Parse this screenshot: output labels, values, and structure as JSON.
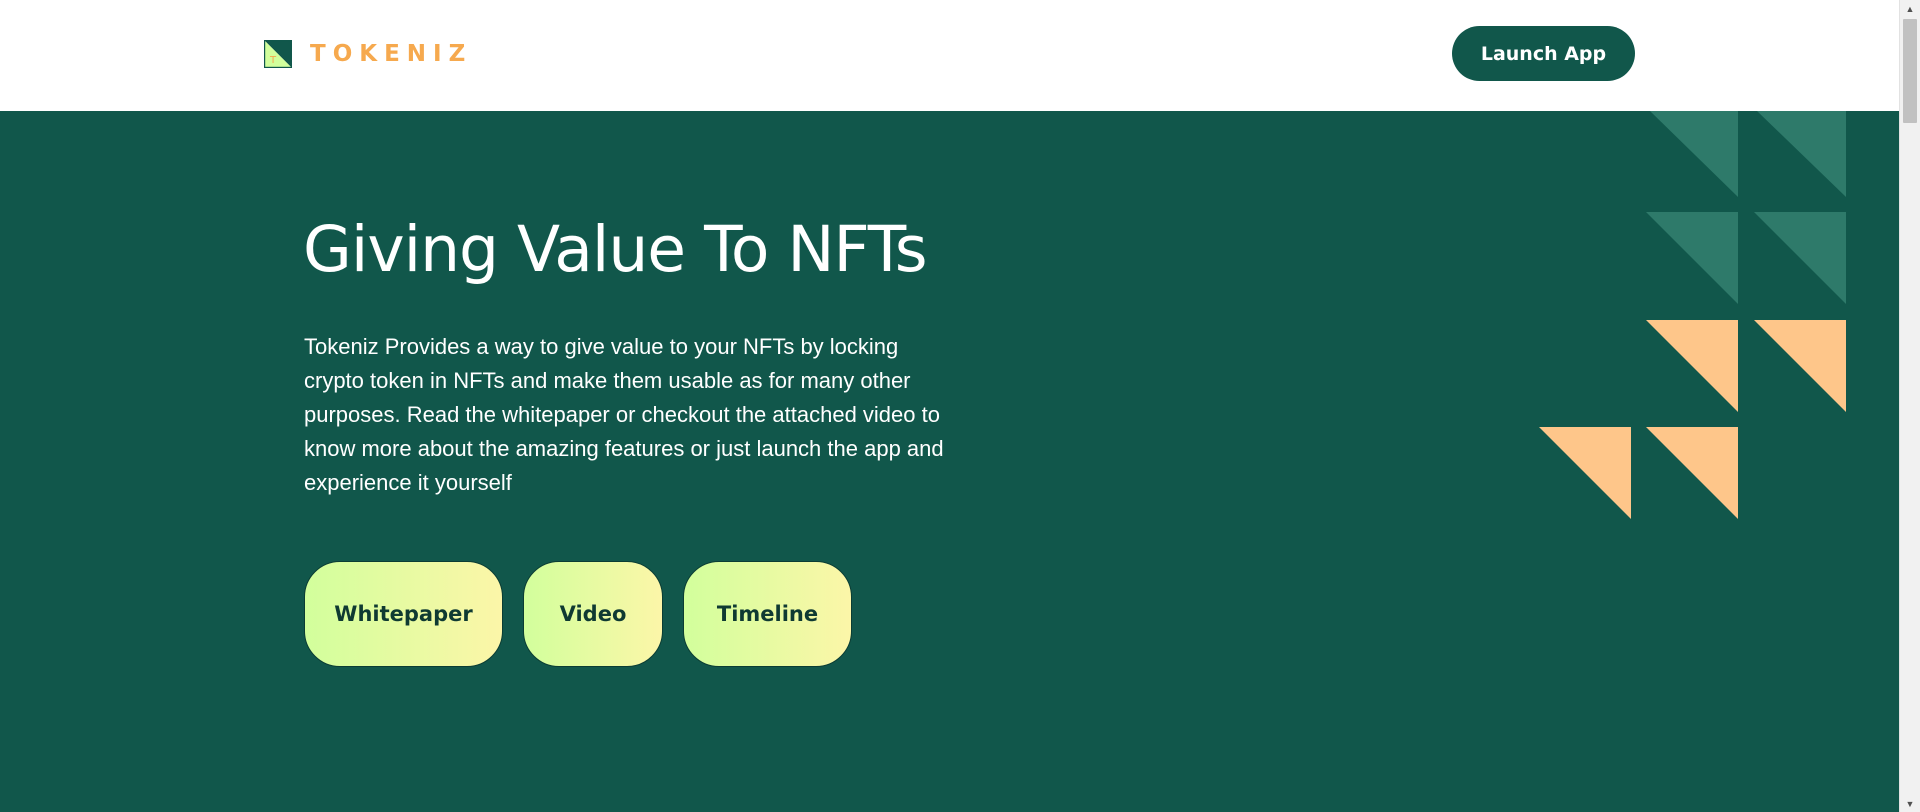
{
  "header": {
    "brand_name": "TOKENIZ",
    "logo_icon": "tokeniz-logo-icon",
    "launch_label": "Launch App"
  },
  "hero": {
    "title": "Giving Value To NFTs",
    "description": "Tokeniz Provides a way to give value to your NFTs by locking crypto token in NFTs and make them usable as for many other purposes. Read the whitepaper or checkout the attached video to know more about the amazing features or just launch the app and experience it yourself",
    "buttons": [
      {
        "label": "Whitepaper"
      },
      {
        "label": "Video"
      },
      {
        "label": "Timeline"
      }
    ]
  },
  "colors": {
    "primary": "#11574B",
    "brand_orange": "#F6A94E",
    "triangle_teal": "#2E7A6A",
    "triangle_peach": "#FEC68A",
    "pill_gradient_start": "#D2FF9C",
    "pill_gradient_end": "#FCF6A8"
  }
}
